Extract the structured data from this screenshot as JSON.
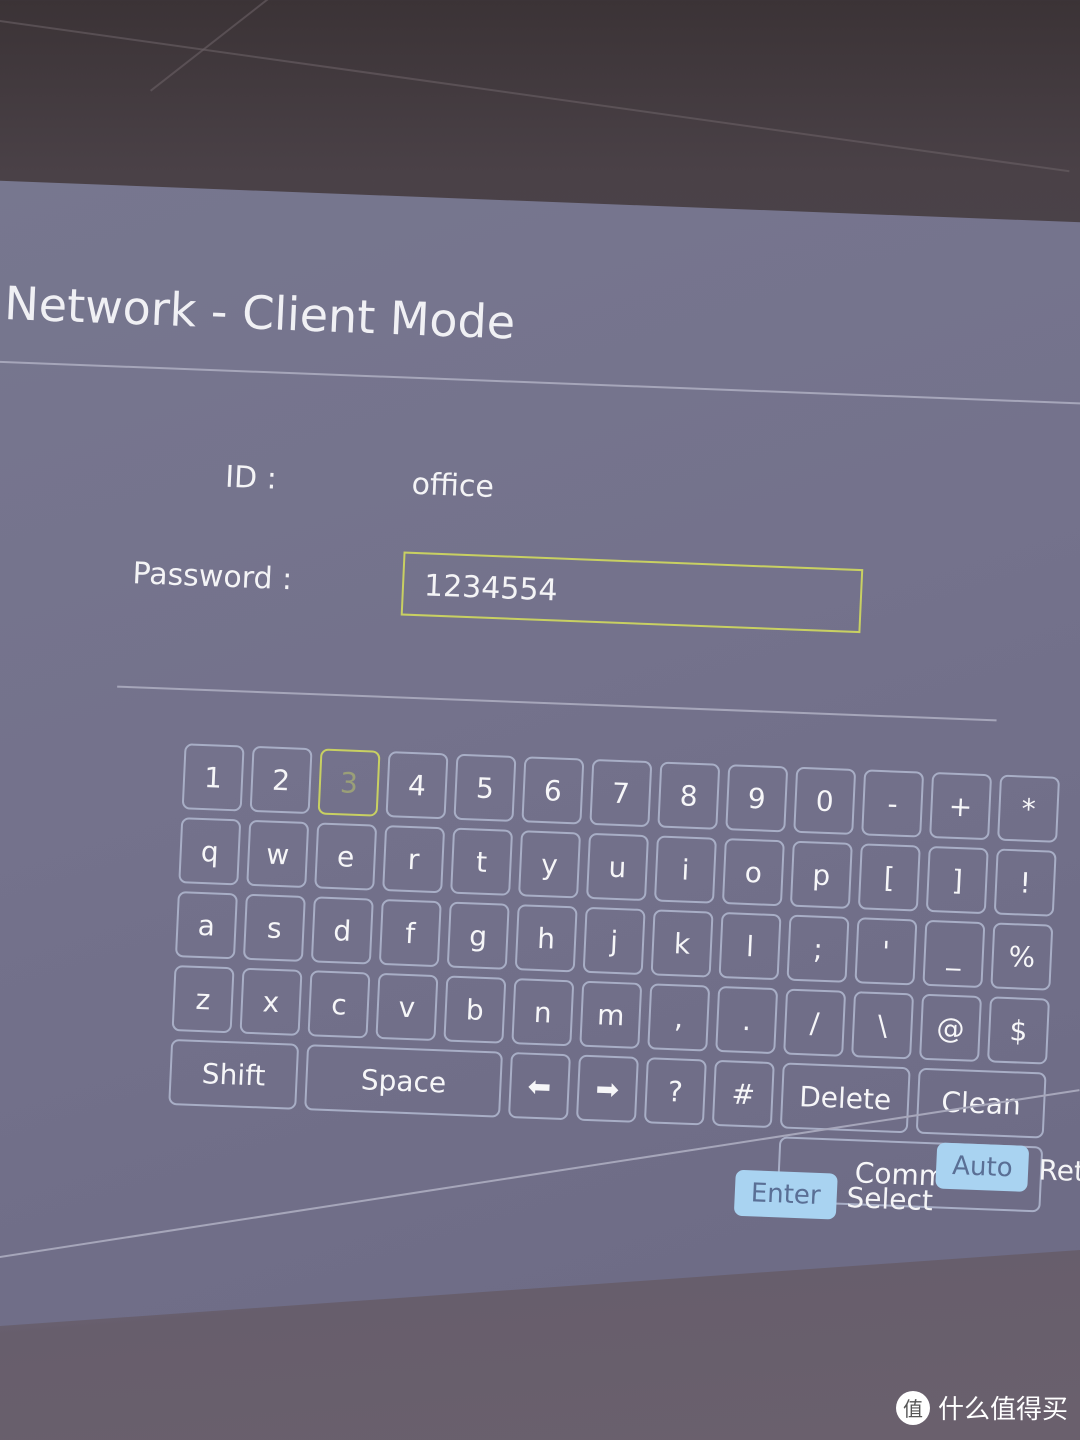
{
  "header": {
    "title": "Network - Client Mode"
  },
  "form": {
    "id_label": "ID :",
    "id_value": "office",
    "password_label": "Password :",
    "password_value": "1234554"
  },
  "keyboard": {
    "selected_key": "3",
    "rows": [
      [
        "1",
        "2",
        "3",
        "4",
        "5",
        "6",
        "7",
        "8",
        "9",
        "0",
        "-",
        "+",
        "*"
      ],
      [
        "q",
        "w",
        "e",
        "r",
        "t",
        "y",
        "u",
        "i",
        "o",
        "p",
        "[",
        "]",
        "!"
      ],
      [
        "a",
        "s",
        "d",
        "f",
        "g",
        "h",
        "j",
        "k",
        "l",
        ";",
        "'",
        "_",
        "%"
      ],
      [
        "z",
        "x",
        "c",
        "v",
        "b",
        "n",
        "m",
        ",",
        ".",
        "/",
        "\\",
        "@",
        "$"
      ]
    ],
    "shift": "Shift",
    "space": "Space",
    "left_arrow": "⬅",
    "right_arrow": "➡",
    "question": "?",
    "hash": "#",
    "delete": "Delete",
    "clean": "Clean",
    "commit": "Commit"
  },
  "footer": {
    "enter_key": "Enter",
    "enter_action": "Select",
    "auto_key": "Auto",
    "auto_action": "Retu"
  },
  "watermark": {
    "icon_text": "值",
    "text": "什么值得买"
  },
  "colors": {
    "focus_border": "#c8d062",
    "key_border": "#a8aec6",
    "badge_bg": "#a9d3f1"
  }
}
